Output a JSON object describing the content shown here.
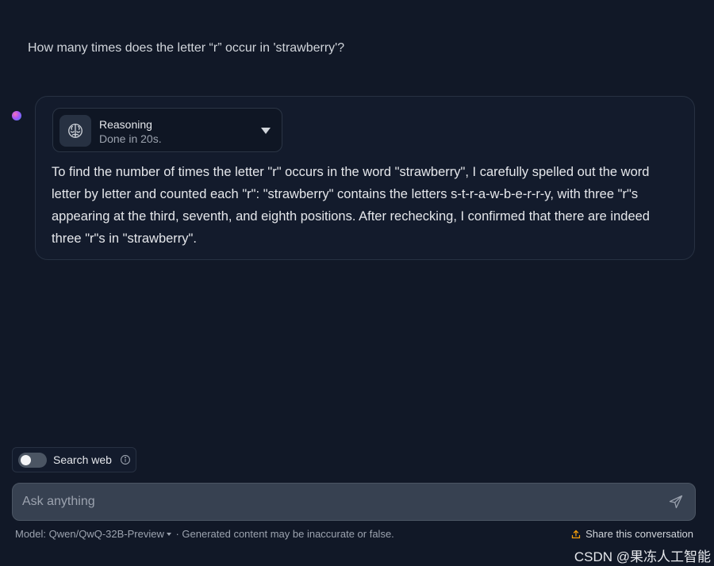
{
  "conversation": {
    "user_question": "How many times does the letter “r” occur in 'strawberry'?",
    "reasoning": {
      "title": "Reasoning",
      "status": "Done in 20s."
    },
    "answer": "To find the number of times the letter \"r\" occurs in the word \"strawberry\", I carefully spelled out the word letter by letter and counted each \"r\": \"strawberry\" contains the letters s-t-r-a-w-b-e-r-r-y, with three \"r\"s appearing at the third, seventh, and eighth positions. After rechecking, I confirmed that there are indeed three \"r\"s in \"strawberry\"."
  },
  "composer": {
    "search_web_label": "Search web",
    "search_web_enabled": false,
    "placeholder": "Ask anything"
  },
  "footer": {
    "model_label": "Model: Qwen/QwQ-32B-Preview",
    "disclaimer": "· Generated content may be inaccurate or false.",
    "share_label": "Share this conversation"
  },
  "watermark": "CSDN @果冻人工智能",
  "icons": {
    "avatar": "assistant-avatar-icon",
    "reasoning": "brain-icon",
    "expand": "chevron-down-icon",
    "info": "info-icon",
    "send": "send-icon",
    "share": "share-icon"
  },
  "colors": {
    "background": "#111827",
    "card": "#131b2c",
    "input": "#374151",
    "share_icon": "#f59e0b"
  }
}
